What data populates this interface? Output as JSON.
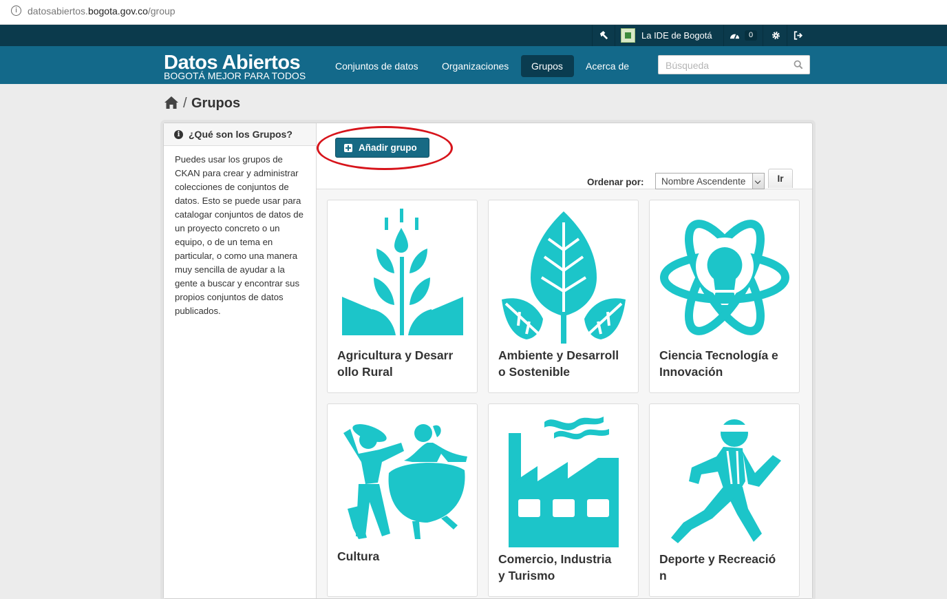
{
  "browser": {
    "url_prefix": "datosabiertos.",
    "url_domain": "bogota.gov.co",
    "url_path": "/group"
  },
  "account": {
    "user_name": "La IDE de Bogotá",
    "activity_count": "0"
  },
  "masthead": {
    "logo_title": "Datos Abiertos",
    "logo_subtitle": "BOGOTÁ MEJOR PARA TODOS",
    "nav": [
      {
        "label": "Conjuntos de datos"
      },
      {
        "label": "Organizaciones"
      },
      {
        "label": "Grupos"
      },
      {
        "label": "Acerca de"
      }
    ],
    "search_placeholder": "Búsqueda"
  },
  "breadcrumb": {
    "separator": "/",
    "current": "Grupos"
  },
  "sidebar": {
    "heading": "¿Qué son los Grupos?",
    "body": "Puedes usar los grupos de CKAN para crear y administrar colecciones de conjuntos de datos. Esto se puede usar para catalogar conjuntos de datos de un proyecto concreto o un equipo, o de un tema en particular, o como una manera muy sencilla de ayudar a la gente a buscar y encontrar sus propios conjuntos de datos publicados."
  },
  "actions": {
    "add_group_label": "Añadir grupo"
  },
  "sort": {
    "label": "Ordenar por:",
    "selected": "Nombre Ascendente",
    "go_label": "Ir"
  },
  "groups": [
    {
      "name": "Agricultura y Desarrollo Rural",
      "icon": "wheat-icon"
    },
    {
      "name": "Ambiente y Desarrollo Sostenible",
      "icon": "leaf-icon"
    },
    {
      "name": "Ciencia Tecnología e Innovación",
      "icon": "atom-bulb-icon"
    },
    {
      "name": "Cultura",
      "icon": "dancers-icon"
    },
    {
      "name": "Comercio, Industria y Turismo",
      "icon": "factory-icon"
    },
    {
      "name": "Deporte y Recreación",
      "icon": "runner-icon"
    }
  ],
  "colors": {
    "accent": "#1cc5c9",
    "masthead": "#13698a",
    "account_bar": "#0b3a4c",
    "highlight": "#d7141b"
  }
}
